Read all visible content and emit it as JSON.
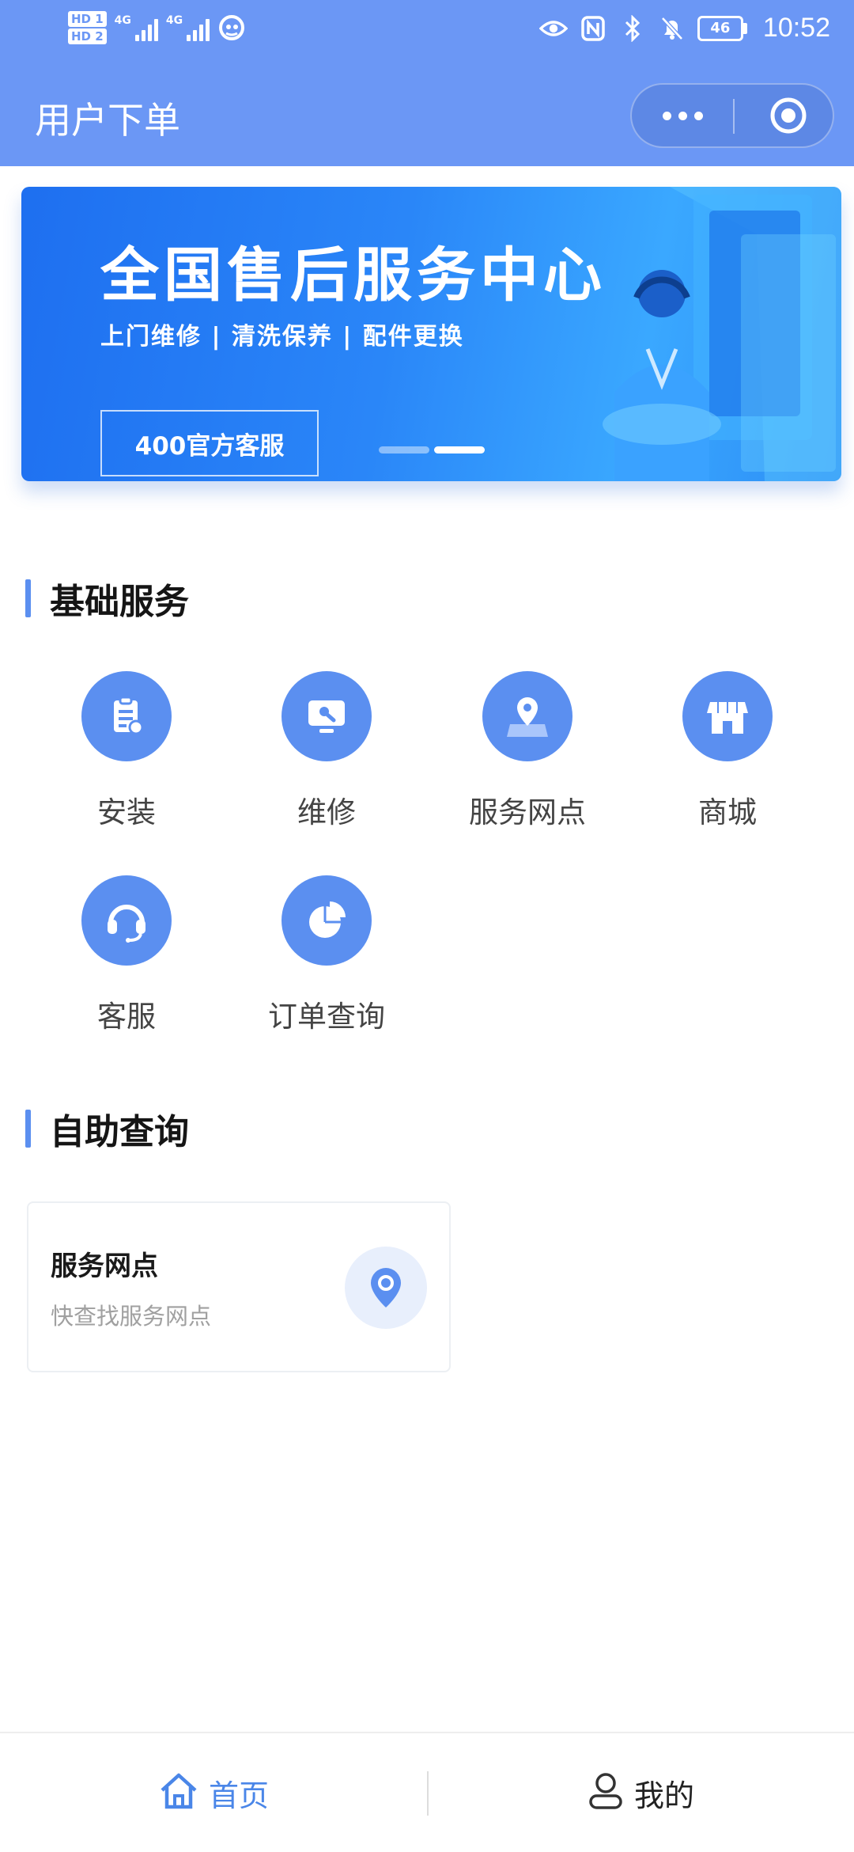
{
  "status_bar": {
    "hd1": "HD 1",
    "hd2": "HD 2",
    "net1": "4G",
    "net2": "4G",
    "battery": "46",
    "time": "10:52"
  },
  "nav": {
    "title": "用户下单",
    "more_icon": "more-dots-icon",
    "close_icon": "target-circle-icon"
  },
  "banner": {
    "title": "全国售后服务中心",
    "subtitle": "上门维修 | 清洗保养 | 配件更换",
    "button": "400官方客服"
  },
  "basic_services": {
    "title": "基础服务",
    "items": [
      {
        "label": "安装",
        "icon": "clipboard-icon"
      },
      {
        "label": "维修",
        "icon": "monitor-wrench-icon"
      },
      {
        "label": "服务网点",
        "icon": "map-pin-icon"
      },
      {
        "label": "商城",
        "icon": "store-icon"
      },
      {
        "label": "客服",
        "icon": "headset-icon"
      },
      {
        "label": "订单查询",
        "icon": "pie-chart-icon"
      }
    ]
  },
  "self_query": {
    "title": "自助查询",
    "card": {
      "title": "服务网点",
      "subtitle": "快查找服务网点",
      "icon": "location-pin-icon"
    }
  },
  "tabbar": {
    "home": {
      "label": "首页",
      "icon": "home-icon"
    },
    "mine": {
      "label": "我的",
      "icon": "user-icon"
    }
  },
  "colors": {
    "primary": "#5b8ff0",
    "header": "#6b97f5",
    "active_tab": "#4a86e8"
  }
}
